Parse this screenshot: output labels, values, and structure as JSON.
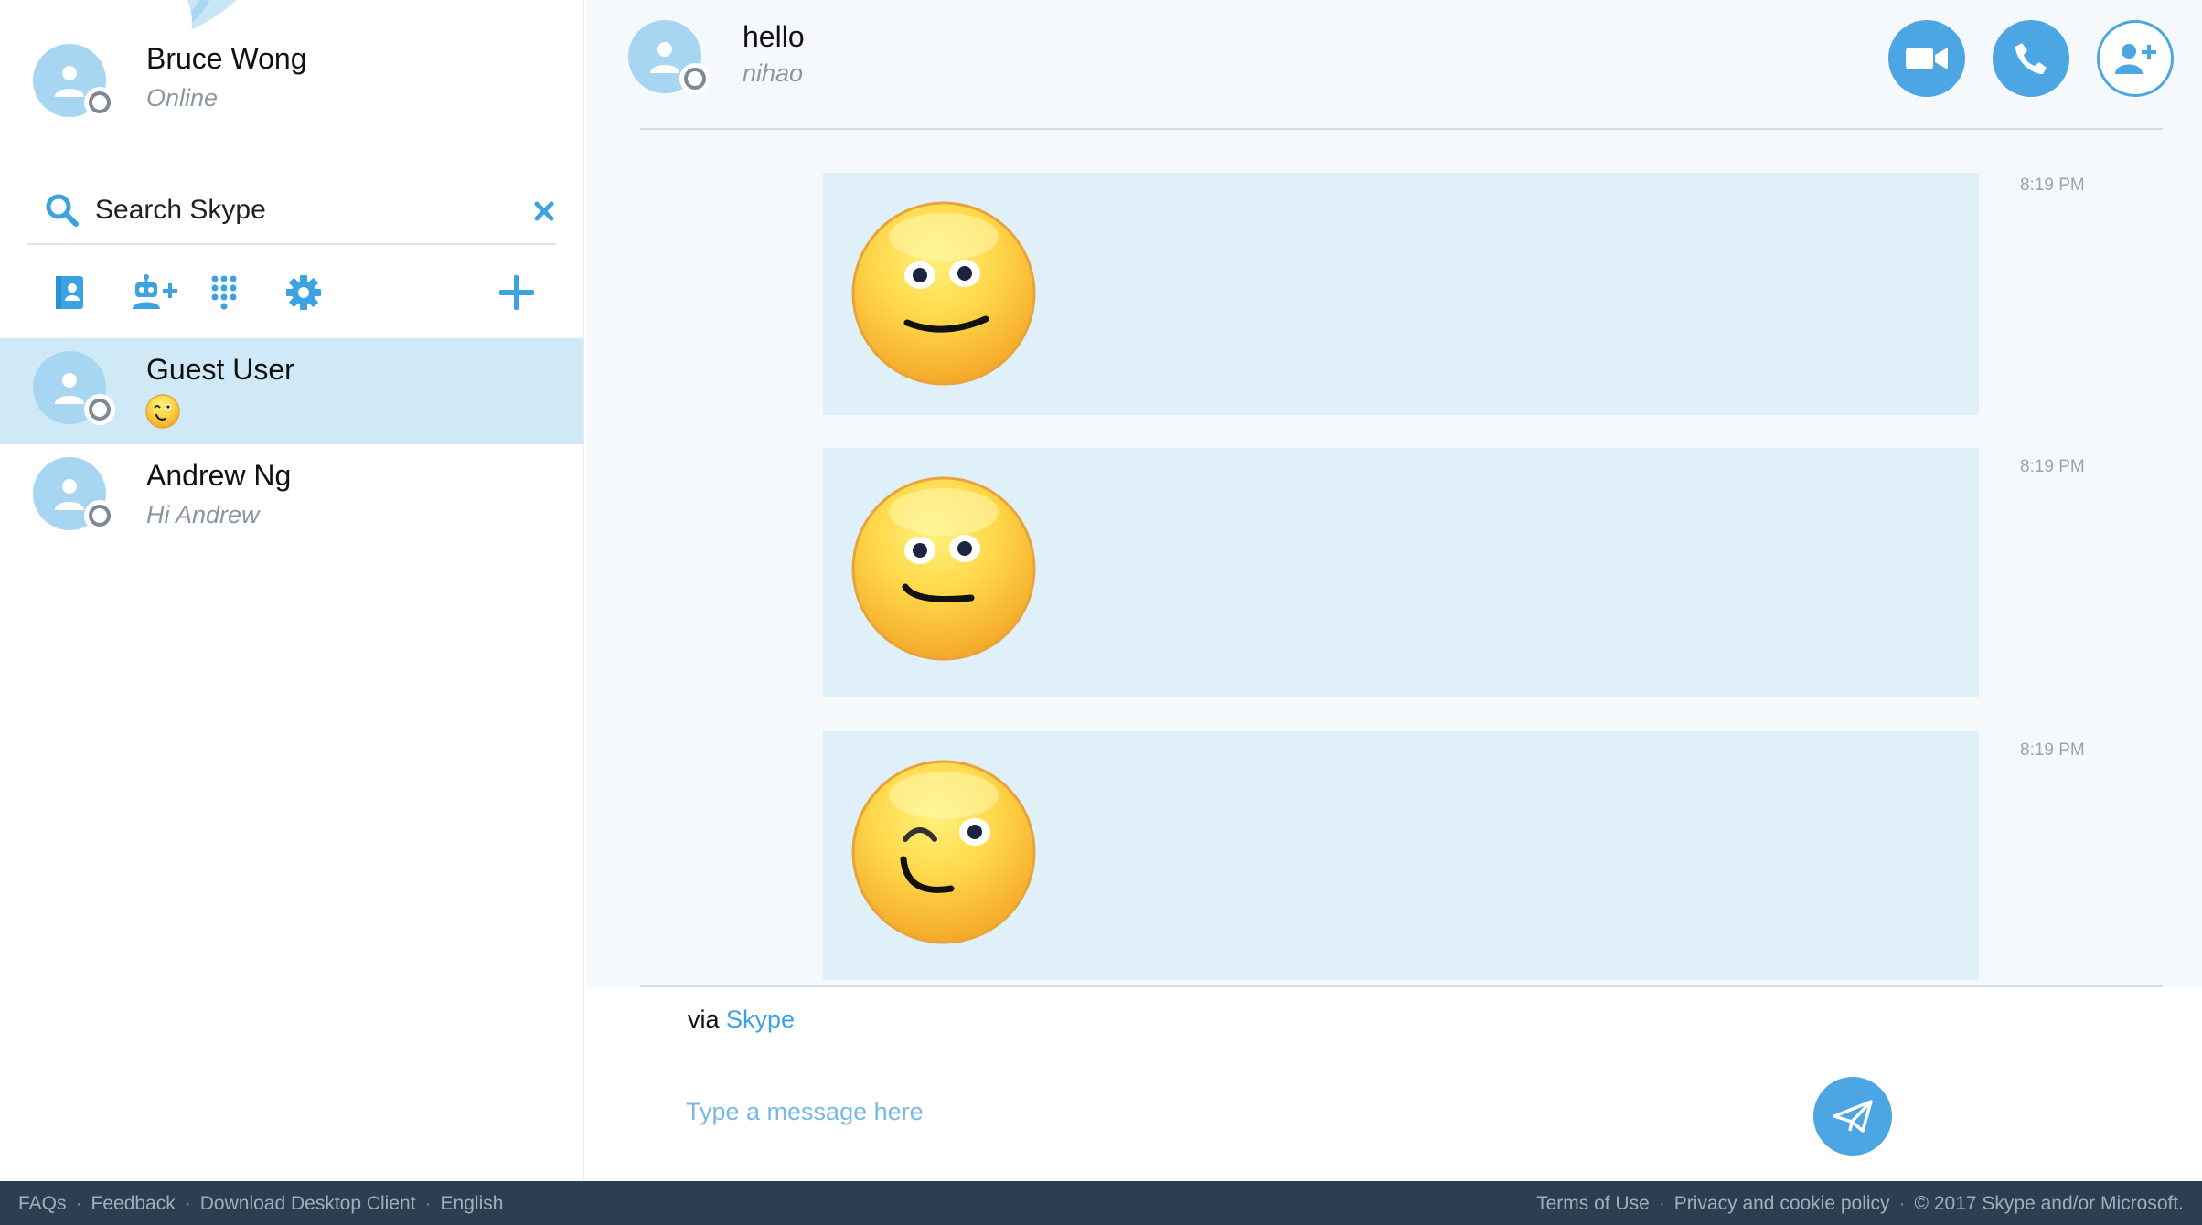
{
  "profile": {
    "name": "Bruce Wong",
    "status": "Online"
  },
  "search": {
    "placeholder": "Search Skype"
  },
  "toolbar": {
    "icons": [
      "contacts-book-icon",
      "add-bot-icon",
      "dialpad-icon",
      "settings-gear-icon",
      "plus-icon"
    ]
  },
  "contacts": [
    {
      "name": "Guest User",
      "subtitle_emoji": "wink-emoticon",
      "selected": true
    },
    {
      "name": "Andrew Ng",
      "subtitle": "Hi Andrew",
      "selected": false
    }
  ],
  "chat": {
    "title": "hello",
    "mood": "nihao",
    "header_buttons": [
      "video-call-icon",
      "voice-call-icon",
      "add-people-icon"
    ],
    "messages": [
      {
        "emoticon": "smile",
        "time": "8:19 PM"
      },
      {
        "emoticon": "smile",
        "time": "8:19 PM"
      },
      {
        "emoticon": "wink",
        "time": "8:19 PM"
      }
    ],
    "via_prefix": "via",
    "via_link": "Skype",
    "input_placeholder": "Type a message here"
  },
  "footer": {
    "left_links": [
      "FAQs",
      "Feedback",
      "Download Desktop Client",
      "English"
    ],
    "right_links": [
      "Terms of Use",
      "Privacy and cookie policy"
    ],
    "copyright": "© 2017 Skype and/or Microsoft."
  },
  "colors": {
    "accent": "#4ca6e3",
    "selected_row": "#cfe9f7",
    "message_bubble": "#dff0f9",
    "footer_bg": "#2b3f50"
  }
}
